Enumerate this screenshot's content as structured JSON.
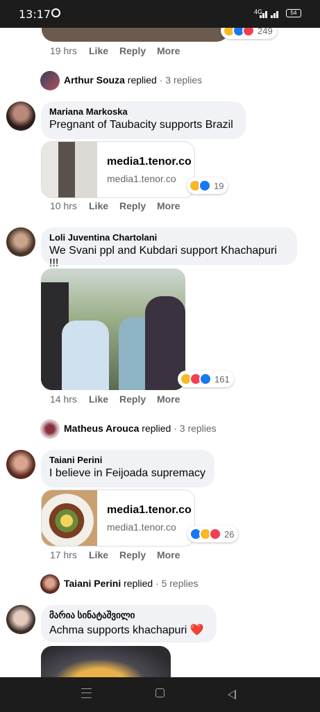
{
  "status_bar": {
    "time": "13:17",
    "network": "4G",
    "battery": "54"
  },
  "top_partial": {
    "time": "19 hrs",
    "reaction_count": "249"
  },
  "actions": {
    "like": "Like",
    "reply": "Reply",
    "more": "More"
  },
  "replied_suffix": "replied",
  "comments": [
    {
      "replied_name": "Arthur Souza",
      "replied_count": "3 replies"
    },
    {
      "name": "Mariana Markoska",
      "text": "Pregnant of Taubacity supports Brazil",
      "link_title": "media1.tenor.co",
      "link_domain": "media1.tenor.co",
      "reaction_count": "19",
      "time": "10 hrs"
    },
    {
      "name": "Loli Juventina Chartolani",
      "text": "We Svani ppl and Kubdari support Khachapuri !!!",
      "reaction_count": "161",
      "time": "14 hrs",
      "replied_name": "Matheus Arouca",
      "replied_count": "3 replies"
    },
    {
      "name": "Taiani Perini",
      "text": "I believe in Feijoada supremacy",
      "link_title": "media1.tenor.co",
      "link_domain": "media1.tenor.co",
      "reaction_count": "26",
      "time": "17 hrs",
      "replied_name": "Taiani Perini",
      "replied_count": "5 replies"
    },
    {
      "name": "მარია სინატაშვილი",
      "text": "Achma supports khachapuri ❤️"
    }
  ],
  "reaction_colors": {
    "like": "#1877f2",
    "haha": "#f7b928",
    "love": "#f33e58"
  }
}
